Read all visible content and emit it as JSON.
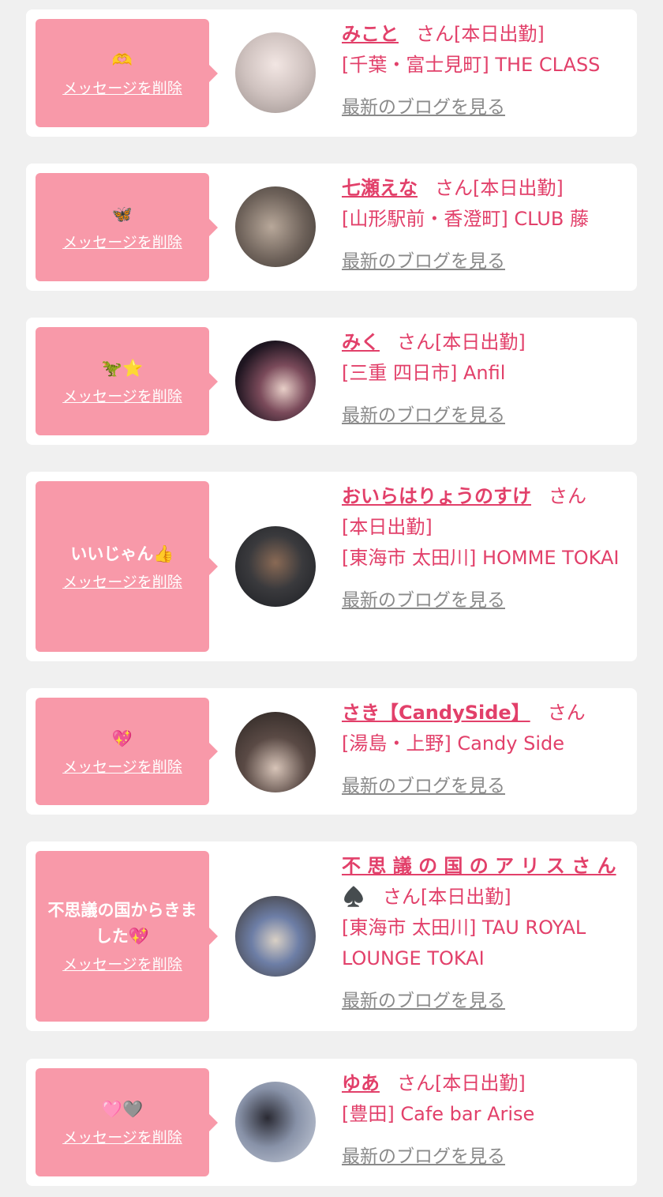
{
  "delete_label": "メッセージを削除",
  "blog_label": "最新のブログを見る",
  "san_label": "さん",
  "shift_label": "[本日出勤]",
  "items": [
    {
      "message": "🫶",
      "name": "みこと",
      "shop": "[千葉・富士見町] THE CLASS"
    },
    {
      "message": "🦋",
      "name": "七瀬えな",
      "shop": "[山形駅前・香澄町] CLUB 藤"
    },
    {
      "message": "🦖⭐",
      "name": "みく",
      "shop": "[三重 四日市] Anfil"
    },
    {
      "message": "いいじゃん👍",
      "name": "おいらはりょうのすけ",
      "shop": "[東海市 太田川] HOMME TOKAI"
    },
    {
      "message": "💖",
      "name": "さき【CandySide】",
      "shop": "[湯島・上野] Candy Side"
    },
    {
      "message": "不思議の国からきました💖",
      "name": "不 思 議 の 国 の ア リ ス さ ん",
      "name_suffix": "♠️",
      "shop": "[東海市 太田川] TAU ROYAL LOUNGE TOKAI"
    },
    {
      "message": "🩷🩶",
      "name": "ゆあ",
      "shop": "[豊田] Cafe bar Arise"
    }
  ],
  "colors": {
    "accent": "#e2406a",
    "bubble": "#f899a9",
    "muted": "#8a8a8a",
    "background": "#f0f0f0"
  },
  "icons": [
    "avatar-photo"
  ]
}
